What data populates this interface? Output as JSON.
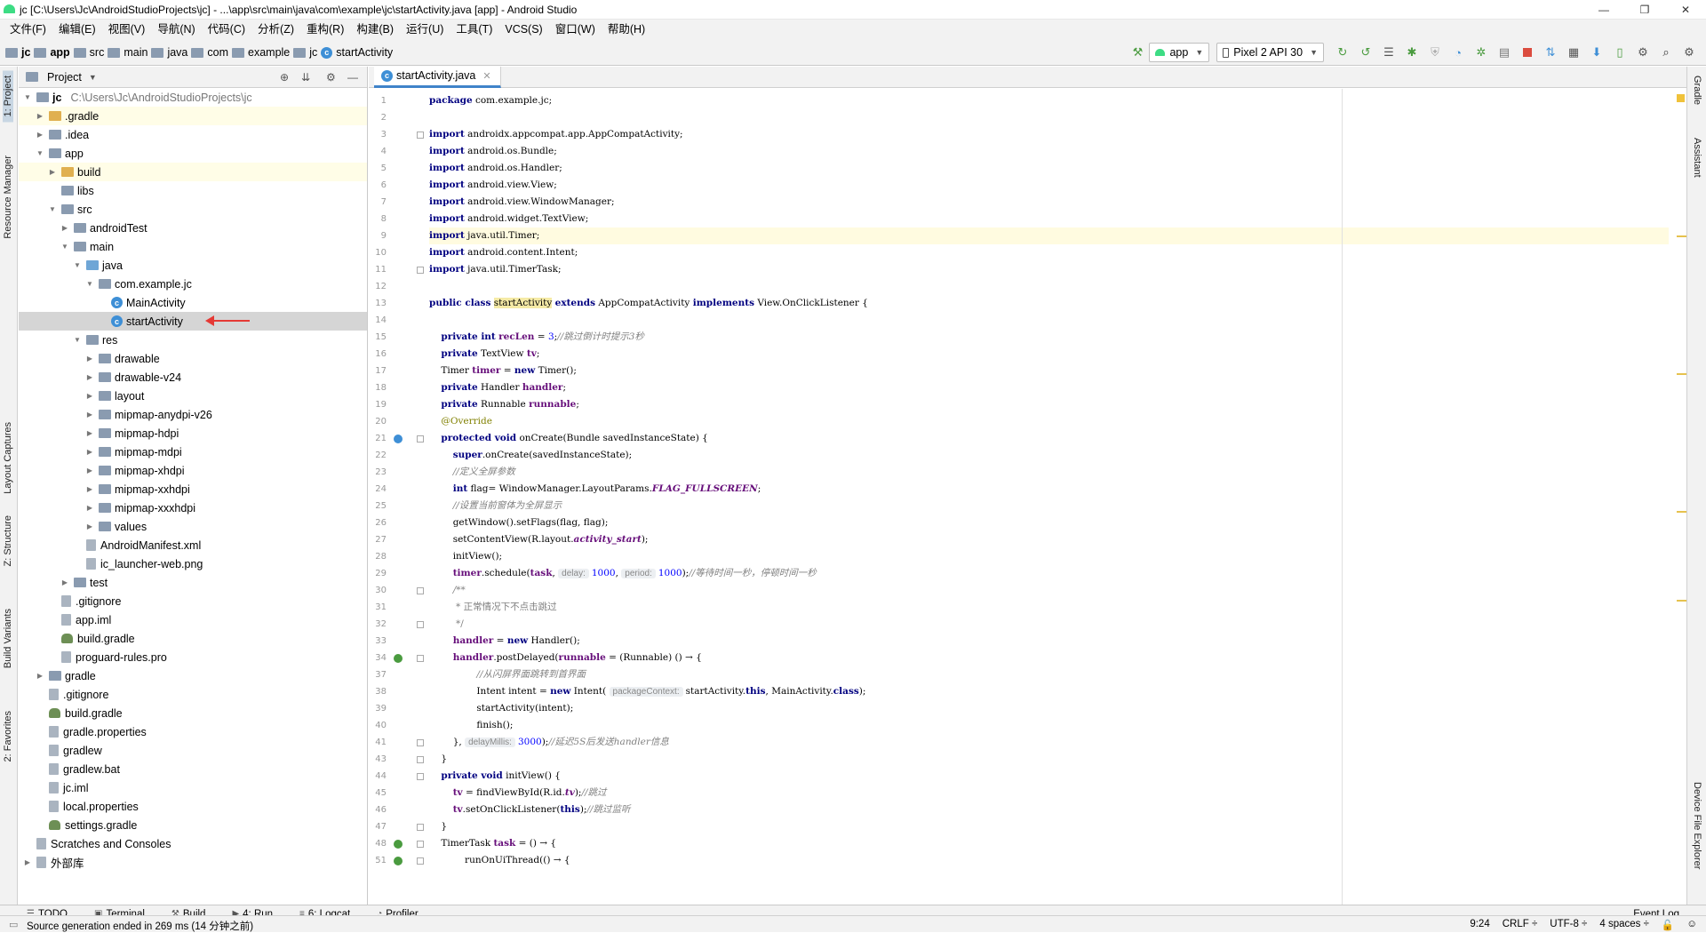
{
  "window": {
    "title": "jc [C:\\Users\\Jc\\AndroidStudioProjects\\jc] - ...\\app\\src\\main\\java\\com\\example\\jc\\startActivity.java [app] - Android Studio",
    "min": "—",
    "max": "❐",
    "close": "✕"
  },
  "menu": [
    "文件(F)",
    "编辑(E)",
    "视图(V)",
    "导航(N)",
    "代码(C)",
    "分析(Z)",
    "重构(R)",
    "构建(B)",
    "运行(U)",
    "工具(T)",
    "VCS(S)",
    "窗口(W)",
    "帮助(H)"
  ],
  "breadcrumbs": [
    "jc",
    "app",
    "src",
    "main",
    "java",
    "com",
    "example",
    "jc",
    "startActivity"
  ],
  "run_config": "app",
  "device": "Pixel 2 API 30",
  "left_tabs": [
    "1: Project",
    "Resource Manager",
    "Layout Captures",
    "Z: Structure",
    "Build Variants",
    "2: Favorites"
  ],
  "right_tabs": [
    "Gradle",
    "Assistant",
    "Device File Explorer"
  ],
  "project": {
    "view": "Project",
    "tree": [
      {
        "label": "jc",
        "path": "C:\\Users\\Jc\\AndroidStudioProjects\\jc",
        "depth": 0,
        "arrow": "▼",
        "icon": "folder"
      },
      {
        "label": ".gradle",
        "depth": 1,
        "arrow": "▶",
        "icon": "folder-y",
        "hl": true
      },
      {
        "label": ".idea",
        "depth": 1,
        "arrow": "▶",
        "icon": "folder"
      },
      {
        "label": "app",
        "depth": 1,
        "arrow": "▼",
        "icon": "folder"
      },
      {
        "label": "build",
        "depth": 2,
        "arrow": "▶",
        "icon": "folder-y",
        "hl": true
      },
      {
        "label": "libs",
        "depth": 2,
        "arrow": "",
        "icon": "folder"
      },
      {
        "label": "src",
        "depth": 2,
        "arrow": "▼",
        "icon": "folder"
      },
      {
        "label": "androidTest",
        "depth": 3,
        "arrow": "▶",
        "icon": "folder"
      },
      {
        "label": "main",
        "depth": 3,
        "arrow": "▼",
        "icon": "folder"
      },
      {
        "label": "java",
        "depth": 4,
        "arrow": "▼",
        "icon": "folder-b"
      },
      {
        "label": "com.example.jc",
        "depth": 5,
        "arrow": "▼",
        "icon": "folder"
      },
      {
        "label": "MainActivity",
        "depth": 6,
        "arrow": "",
        "icon": "class"
      },
      {
        "label": "startActivity",
        "depth": 6,
        "arrow": "",
        "icon": "class",
        "sel": true
      },
      {
        "label": "res",
        "depth": 4,
        "arrow": "▼",
        "icon": "folder"
      },
      {
        "label": "drawable",
        "depth": 5,
        "arrow": "▶",
        "icon": "folder"
      },
      {
        "label": "drawable-v24",
        "depth": 5,
        "arrow": "▶",
        "icon": "folder"
      },
      {
        "label": "layout",
        "depth": 5,
        "arrow": "▶",
        "icon": "folder"
      },
      {
        "label": "mipmap-anydpi-v26",
        "depth": 5,
        "arrow": "▶",
        "icon": "folder"
      },
      {
        "label": "mipmap-hdpi",
        "depth": 5,
        "arrow": "▶",
        "icon": "folder"
      },
      {
        "label": "mipmap-mdpi",
        "depth": 5,
        "arrow": "▶",
        "icon": "folder"
      },
      {
        "label": "mipmap-xhdpi",
        "depth": 5,
        "arrow": "▶",
        "icon": "folder"
      },
      {
        "label": "mipmap-xxhdpi",
        "depth": 5,
        "arrow": "▶",
        "icon": "folder"
      },
      {
        "label": "mipmap-xxxhdpi",
        "depth": 5,
        "arrow": "▶",
        "icon": "folder"
      },
      {
        "label": "values",
        "depth": 5,
        "arrow": "▶",
        "icon": "folder"
      },
      {
        "label": "AndroidManifest.xml",
        "depth": 4,
        "arrow": "",
        "icon": "file"
      },
      {
        "label": "ic_launcher-web.png",
        "depth": 4,
        "arrow": "",
        "icon": "file"
      },
      {
        "label": "test",
        "depth": 3,
        "arrow": "▶",
        "icon": "folder"
      },
      {
        "label": ".gitignore",
        "depth": 2,
        "arrow": "",
        "icon": "file"
      },
      {
        "label": "app.iml",
        "depth": 2,
        "arrow": "",
        "icon": "file"
      },
      {
        "label": "build.gradle",
        "depth": 2,
        "arrow": "",
        "icon": "gradle"
      },
      {
        "label": "proguard-rules.pro",
        "depth": 2,
        "arrow": "",
        "icon": "file"
      },
      {
        "label": "gradle",
        "depth": 1,
        "arrow": "▶",
        "icon": "folder"
      },
      {
        "label": ".gitignore",
        "depth": 1,
        "arrow": "",
        "icon": "file"
      },
      {
        "label": "build.gradle",
        "depth": 1,
        "arrow": "",
        "icon": "gradle"
      },
      {
        "label": "gradle.properties",
        "depth": 1,
        "arrow": "",
        "icon": "file"
      },
      {
        "label": "gradlew",
        "depth": 1,
        "arrow": "",
        "icon": "file"
      },
      {
        "label": "gradlew.bat",
        "depth": 1,
        "arrow": "",
        "icon": "file"
      },
      {
        "label": "jc.iml",
        "depth": 1,
        "arrow": "",
        "icon": "file"
      },
      {
        "label": "local.properties",
        "depth": 1,
        "arrow": "",
        "icon": "file"
      },
      {
        "label": "settings.gradle",
        "depth": 1,
        "arrow": "",
        "icon": "gradle"
      },
      {
        "label": "Scratches and Consoles",
        "depth": 0,
        "arrow": "",
        "icon": "file"
      },
      {
        "label": "外部库",
        "depth": 0,
        "arrow": "▶",
        "icon": "file"
      }
    ]
  },
  "editor": {
    "tab": "startActivity.java",
    "lines": [
      {
        "n": "1",
        "h": "<span class='kw'>package</span> com.example.jc;"
      },
      {
        "n": "2",
        "h": ""
      },
      {
        "n": "3",
        "h": "<span class='kw'>import</span> androidx.appcompat.app.AppCompatActivity;"
      },
      {
        "n": "4",
        "h": "<span class='kw'>import</span> android.os.Bundle;"
      },
      {
        "n": "5",
        "h": "<span class='kw'>import</span> android.os.Handler;"
      },
      {
        "n": "6",
        "h": "<span class='kw'>import</span> android.view.View;"
      },
      {
        "n": "7",
        "h": "<span class='kw'>import</span> android.view.WindowManager;"
      },
      {
        "n": "8",
        "h": "<span class='kw'>import</span> android.widget.TextView;"
      },
      {
        "n": "9",
        "h": "<span class='kw'>import</span> java.util.Timer;",
        "caret": true
      },
      {
        "n": "10",
        "h": "<span class='kw'>import</span> android.content.Intent;"
      },
      {
        "n": "11",
        "h": "<span class='kw'>import</span> java.util.TimerTask;"
      },
      {
        "n": "12",
        "h": ""
      },
      {
        "n": "13",
        "h": "<span class='kw'>public class</span> <span style='background:#f5eaa6'>startActivity</span> <span class='kw'>extends</span> AppCompatActivity <span class='kw'>implements</span> View.OnClickListener {"
      },
      {
        "n": "14",
        "h": ""
      },
      {
        "n": "15",
        "h": "    <span class='kw'>private int</span> <span class='fld'>recLen</span> = <span class='num'>3</span>;<span class='cm'>//跳过倒计时提示3秒</span>"
      },
      {
        "n": "16",
        "h": "    <span class='kw'>private</span> TextView <span class='fld'>tv</span>;"
      },
      {
        "n": "17",
        "h": "    Timer <span class='fld'>timer</span> = <span class='kw'>new</span> Timer();"
      },
      {
        "n": "18",
        "h": "    <span class='kw'>private</span> Handler <span class='fld'>handler</span>;"
      },
      {
        "n": "19",
        "h": "    <span class='kw'>private</span> Runnable <span class='fld'>runnable</span>;"
      },
      {
        "n": "20",
        "h": "    <span class='an'>@Override</span>"
      },
      {
        "n": "21",
        "h": "    <span class='kw'>protected void</span> onCreate(Bundle savedInstanceState) {"
      },
      {
        "n": "22",
        "h": "        <span class='kw'>super</span>.onCreate(savedInstanceState);"
      },
      {
        "n": "23",
        "h": "        <span class='cm'>//定义全屏参数</span>"
      },
      {
        "n": "24",
        "h": "        <span class='kw'>int</span> flag= WindowManager.LayoutParams.<span class='st'>FLAG_FULLSCREEN</span>;"
      },
      {
        "n": "25",
        "h": "        <span class='cm'>//设置当前窗体为全屏显示</span>"
      },
      {
        "n": "26",
        "h": "        getWindow().setFlags(flag, flag);"
      },
      {
        "n": "27",
        "h": "        setContentView(R.layout.<span class='st'>activity_start</span>);"
      },
      {
        "n": "28",
        "h": "        initView();"
      },
      {
        "n": "29",
        "h": "        <span class='fld'>timer</span>.schedule(<span class='fld'>task</span>, <span class='hint'>delay:</span><span class='num'>1000</span>, <span class='hint'>period:</span><span class='num'>1000</span>);<span class='cm'>//等待时间一秒，停顿时间一秒</span>"
      },
      {
        "n": "30",
        "h": "        <span class='cm'>/**</span>"
      },
      {
        "n": "31",
        "h": "<span class='cmp'>         * 正常情况下不点击跳过</span>"
      },
      {
        "n": "32",
        "h": "<span class='cmp'>         */</span>"
      },
      {
        "n": "33",
        "h": "        <span class='fld'>handler</span> = <span class='kw'>new</span> Handler();"
      },
      {
        "n": "34",
        "h": "        <span class='fld'>handler</span>.postDelayed(<span class='fld'>runnable</span> = (Runnable) () → {"
      },
      {
        "n": "37",
        "h": "                <span class='cm'>//从闪屏界面跳转到首界面</span>"
      },
      {
        "n": "38",
        "h": "                Intent intent = <span class='kw'>new</span> Intent( <span class='hint'>packageContext:</span>startActivity.<span class='kw'>this</span>, MainActivity.<span class='kw'>class</span>);"
      },
      {
        "n": "39",
        "h": "                startActivity(intent);"
      },
      {
        "n": "40",
        "h": "                finish();"
      },
      {
        "n": "41",
        "h": "        }, <span class='hint'>delayMillis:</span><span class='num'>3000</span>);<span class='cm'>//延迟5S后发送handler信息</span>"
      },
      {
        "n": "43",
        "h": "    }"
      },
      {
        "n": "44",
        "h": "    <span class='kw'>private void</span> initView() {"
      },
      {
        "n": "45",
        "h": "        <span class='fld'>tv</span> = findViewById(R.id.<span class='st'>tv</span>);<span class='cm'>//跳过</span>"
      },
      {
        "n": "46",
        "h": "        <span class='fld'>tv</span>.setOnClickListener(<span class='kw'>this</span>);<span class='cm'>//跳过监听</span>"
      },
      {
        "n": "47",
        "h": "    }"
      },
      {
        "n": "48",
        "h": "    TimerTask <span class='fld'>task</span> = () → {"
      },
      {
        "n": "51",
        "h": "            runOnUiThread(() → {"
      }
    ]
  },
  "toolwindows": [
    {
      "icon": "☰",
      "label": "TODO"
    },
    {
      "icon": "▣",
      "label": "Terminal"
    },
    {
      "icon": "⚒",
      "label": "Build"
    },
    {
      "icon": "▶",
      "label": "4: Run"
    },
    {
      "icon": "≡",
      "label": "6: Logcat"
    },
    {
      "icon": "◔",
      "label": "Profiler"
    }
  ],
  "event_log": "Event Log",
  "status": {
    "message": "Source generation ended in 269 ms (14 分钟之前)",
    "pos": "9:24",
    "eol": "CRLF ÷",
    "enc": "UTF-8 ÷",
    "indent": "4 spaces ÷"
  }
}
